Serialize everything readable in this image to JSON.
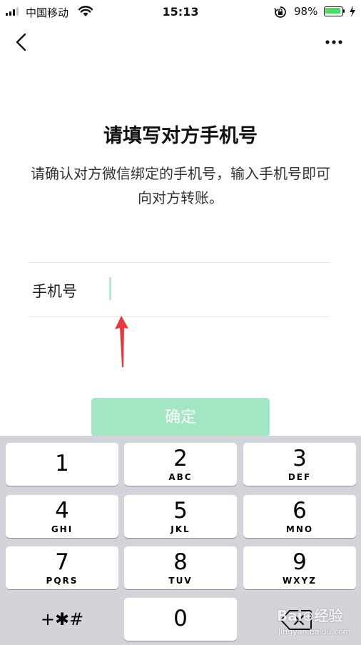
{
  "status_bar": {
    "carrier": "中国移动",
    "time": "15:13",
    "battery_percent": "98%",
    "battery_level": 0.98,
    "icons": [
      "signal-icon",
      "wifi-icon",
      "rotation-lock-icon",
      "battery-icon",
      "charging-icon"
    ]
  },
  "nav": {
    "back_icon": "chevron-left-icon",
    "more_icon": "more-icon"
  },
  "page": {
    "title": "请填写对方手机号",
    "description": "请确认对方微信绑定的手机号，输入手机号即可向对方转账。"
  },
  "form": {
    "phone_label": "手机号",
    "phone_value": "",
    "cursor_color": "#b4e8cf"
  },
  "confirm_button": {
    "label": "确定",
    "color": "#a3e6c3"
  },
  "keypad": {
    "keys": [
      {
        "digit": "1",
        "letters": ""
      },
      {
        "digit": "2",
        "letters": "ABC"
      },
      {
        "digit": "3",
        "letters": "DEF"
      },
      {
        "digit": "4",
        "letters": "GHI"
      },
      {
        "digit": "5",
        "letters": "JKL"
      },
      {
        "digit": "6",
        "letters": "MNO"
      },
      {
        "digit": "7",
        "letters": "PQRS"
      },
      {
        "digit": "8",
        "letters": "TUV"
      },
      {
        "digit": "9",
        "letters": "WXYZ"
      },
      {
        "digit": "0",
        "letters": ""
      }
    ],
    "symbols_label": "+✱#",
    "delete_icon": "backspace-icon",
    "background": "#d2d4da"
  },
  "annotation": {
    "arrow_color": "#e8383d"
  },
  "watermark": {
    "line1": "Bai⊕经验",
    "line2": "jingyan.baidu.com"
  }
}
